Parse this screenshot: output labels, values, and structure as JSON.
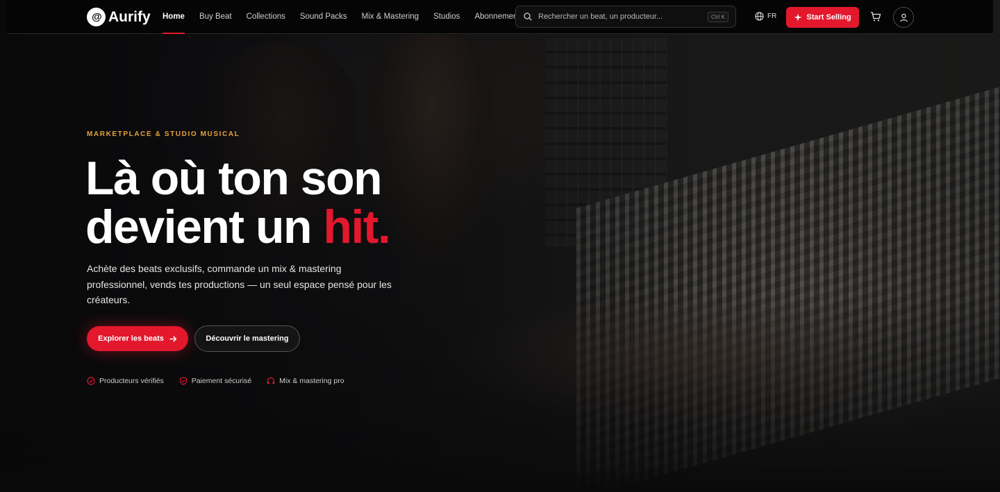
{
  "brand": {
    "logo_mark": "@",
    "name": "Aurify"
  },
  "nav": {
    "items": [
      {
        "label": "Home",
        "active": true
      },
      {
        "label": "Buy Beat"
      },
      {
        "label": "Collections"
      },
      {
        "label": "Sound Packs"
      },
      {
        "label": "Mix & Mastering"
      },
      {
        "label": "Studios"
      },
      {
        "label": "Abonnements"
      }
    ],
    "search": {
      "placeholder": "Rechercher un beat, un producteur...",
      "shortcut": "Ctrl K"
    },
    "language": "FR",
    "sell_button": "Start Selling"
  },
  "hero": {
    "eyebrow": "MARKETPLACE & STUDIO MUSICAL",
    "title_line1": "Là où ton son",
    "title_line2_prefix": "devient un ",
    "title_highlight": "hit.",
    "description": "Achète des beats exclusifs, commande un mix & mastering professionnel, vends tes productions — un seul espace pensé pour les créateurs.",
    "primary_cta": "Explorer les beats",
    "secondary_cta": "Découvrir le mastering",
    "badges": [
      {
        "label": "Producteurs vérifiés",
        "icon": "check-circle-icon"
      },
      {
        "label": "Paiement sécurisé",
        "icon": "shield-check-icon"
      },
      {
        "label": "Mix & mastering pro",
        "icon": "headphones-icon"
      }
    ]
  },
  "colors": {
    "accent": "#e3182d",
    "eyebrow": "#e8a23b",
    "nav_bg": "#050505"
  }
}
